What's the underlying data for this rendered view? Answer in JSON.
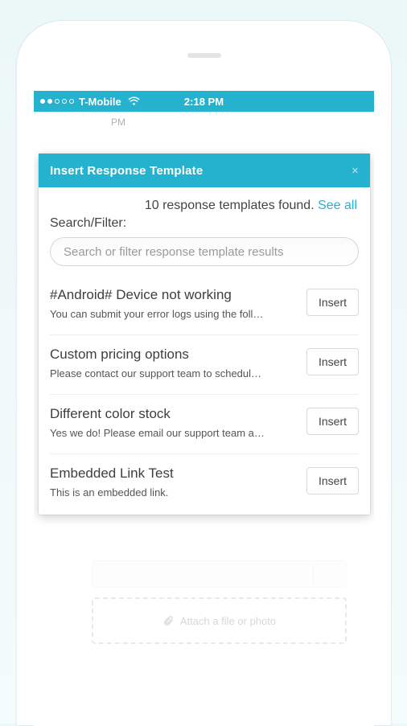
{
  "status_bar": {
    "carrier": "T-Mobile",
    "time": "2:18 PM"
  },
  "background": {
    "pm_text": "PM",
    "attach_label": "Attach a file or photo"
  },
  "modal": {
    "title": "Insert Response Template",
    "close_label": "×",
    "found_prefix": "10 response templates found. ",
    "see_all_label": "See all",
    "filter_label": "Search/Filter:",
    "search_placeholder": "Search or filter response template results",
    "insert_label": "Insert",
    "templates": [
      {
        "title": "#Android# Device not working",
        "preview": "You can submit your error logs using the foll…"
      },
      {
        "title": "Custom pricing options",
        "preview": "Please contact our support team to schedul…"
      },
      {
        "title": "Different color stock",
        "preview": "Yes we do! Please email our support team a…"
      },
      {
        "title": "Embedded Link Test",
        "preview": "This is an embedded link."
      }
    ]
  }
}
